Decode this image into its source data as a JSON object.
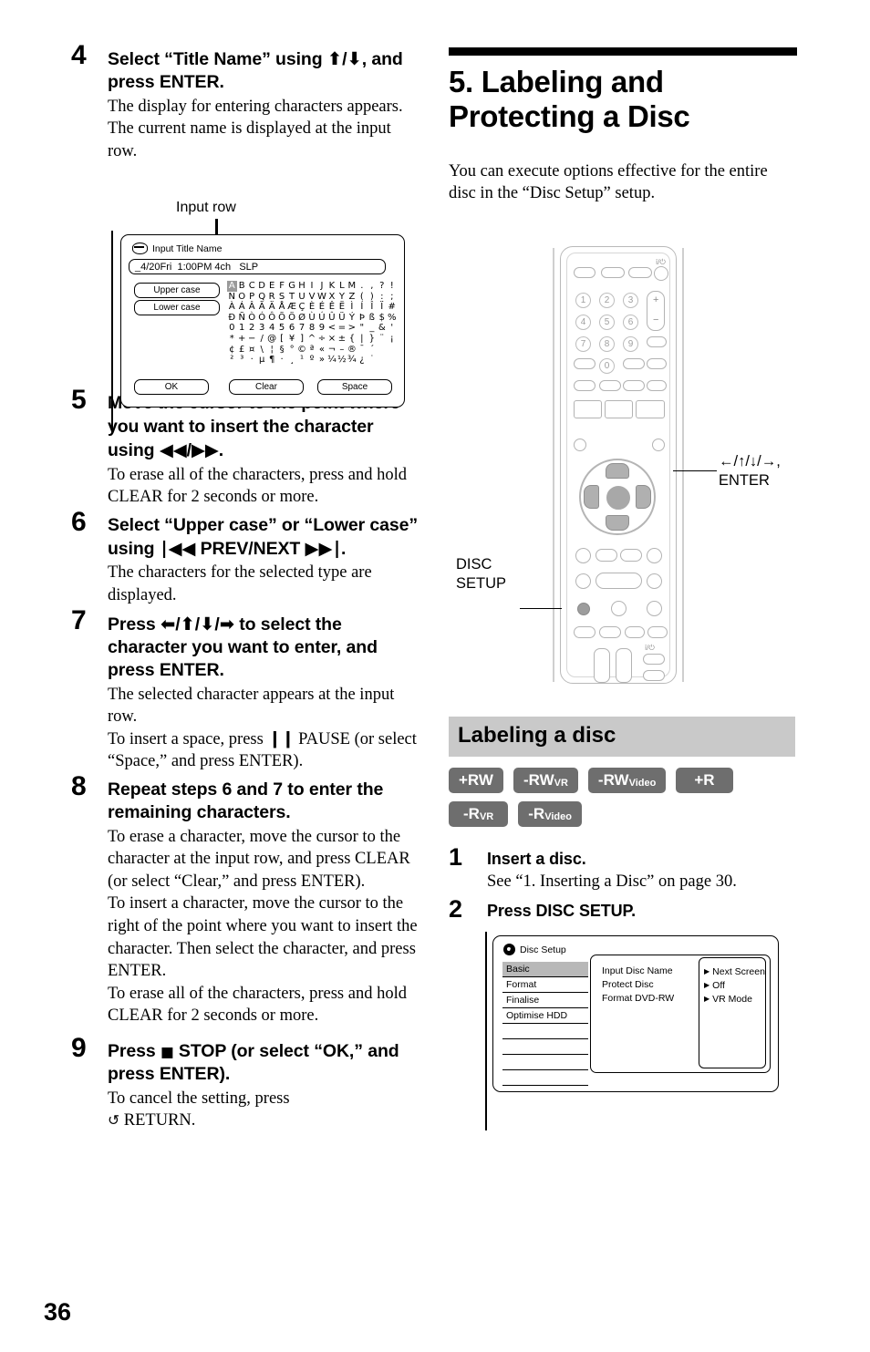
{
  "page_number": "36",
  "left_column": {
    "steps": [
      {
        "num": "4",
        "heading": "Select “Title Name” using ↑/↓, and press ENTER.",
        "body": [
          "The display for entering characters appears.",
          "The current name is displayed at the input row."
        ]
      },
      {
        "num": "5",
        "heading": "Move the cursor to the point where you want to insert the character using ◀◀/▶▶.",
        "body": [
          "To erase all of the characters, press and hold CLEAR for 2 seconds or more."
        ]
      },
      {
        "num": "6",
        "heading": "Select “Upper case” or “Lower case” using |◀◀ PREV/NEXT ▶▶|.",
        "body": [
          "The characters for the selected type are displayed."
        ]
      },
      {
        "num": "7",
        "heading": "Press ←/↑/↓/→ to select the character you want to enter, and press ENTER.",
        "body": [
          "The selected character appears at the input row.",
          "To insert a space, press ‖ PAUSE (or select “Space,” and press ENTER)."
        ]
      },
      {
        "num": "8",
        "heading": "Repeat steps 6 and 7 to enter the remaining characters.",
        "body": [
          "To erase a character, move the cursor to the character at the input row, and press CLEAR (or select “Clear,” and press ENTER).",
          "To insert a character, move the cursor to the right of the point where you want to insert the character. Then select the character, and press ENTER.",
          "To erase all of the characters, press and hold CLEAR for 2 seconds or more."
        ]
      },
      {
        "num": "9",
        "heading": "Press ■ STOP (or select “OK,” and press ENTER).",
        "body": [
          "To cancel the setting, press ۩ RETURN."
        ]
      }
    ],
    "input_screen": {
      "callout_label": "Input row",
      "title": "Input Title Name",
      "input_value": "_4/20Fri  1:00PM 4ch   SLP",
      "case_buttons": [
        "Upper case",
        "Lower case"
      ],
      "bottom_buttons": [
        "OK",
        "Clear",
        "Space"
      ],
      "charmap_rows": [
        [
          "A",
          "B",
          "C",
          "D",
          "E",
          "F",
          "G",
          "H",
          "I",
          "J",
          "K",
          "L",
          "M",
          ".",
          ",",
          "?",
          "!"
        ],
        [
          "N",
          "O",
          "P",
          "Q",
          "R",
          "S",
          "T",
          "U",
          "V",
          "W",
          "X",
          "Y",
          "Z",
          "(",
          ")",
          ":",
          ";"
        ],
        [
          "À",
          "Á",
          "Â",
          "Ã",
          "Ä",
          "Å",
          "Æ",
          "Ç",
          "È",
          "É",
          "Ê",
          "Ë",
          "Ì",
          "Í",
          "Î",
          "Ï",
          "#"
        ],
        [
          "Ð",
          "Ñ",
          "Ò",
          "Ó",
          "Ô",
          "Õ",
          "Ö",
          "Ø",
          "Ù",
          "Ú",
          "Û",
          "Ü",
          "Ý",
          "Þ",
          "ß",
          "$",
          "%"
        ],
        [
          "0",
          "1",
          "2",
          "3",
          "4",
          "5",
          "6",
          "7",
          "8",
          "9",
          "<",
          "=",
          ">",
          "\"",
          "_",
          "&",
          "'"
        ],
        [
          "*",
          "+",
          "−",
          "/",
          "@",
          "[",
          "¥",
          "]",
          "^",
          "÷",
          "×",
          "±",
          "{",
          "|",
          "}",
          "¨",
          "¡"
        ],
        [
          "¢",
          "£",
          "¤",
          "\\",
          "¦",
          "§",
          "°",
          "©",
          "ª",
          "«",
          "¬",
          "–",
          "®",
          "¯",
          "´",
          "",
          " "
        ],
        [
          "²",
          "³",
          "·",
          "µ",
          "¶",
          "·",
          "¸",
          "¹",
          "º",
          "»",
          "¼",
          "½",
          "¾",
          "¿",
          "˙",
          "",
          ""
        ]
      ],
      "selected_char": "A"
    }
  },
  "right_column": {
    "section_title": "5. Labeling and Protecting a Disc",
    "intro": "You can execute options effective for the entire disc in the “Disc Setup” setup.",
    "remote_callouts": {
      "dpad": "←/↑/↓/→,\nENTER",
      "dpad_line1": "←/↑/↓/→,",
      "dpad_line2": "ENTER",
      "disc_setup_line1": "DISC",
      "disc_setup_line2": "SETUP"
    },
    "remote_number_keys": [
      "1",
      "2",
      "3",
      "4",
      "5",
      "6",
      "7",
      "8",
      "9",
      "0"
    ],
    "subsection": {
      "title": "Labeling a disc",
      "badges": [
        {
          "main": "+RW",
          "sub": ""
        },
        {
          "main": "-RW",
          "sub": "VR"
        },
        {
          "main": "-RW",
          "sub": "Video"
        },
        {
          "main": "+R",
          "sub": ""
        },
        {
          "main": "-R",
          "sub": "VR"
        },
        {
          "main": "-R",
          "sub": "Video"
        }
      ],
      "steps": [
        {
          "num": "1",
          "heading": "Insert a disc.",
          "body": [
            "See “1. Inserting a Disc” on page 30."
          ]
        },
        {
          "num": "2",
          "heading": "Press DISC SETUP.",
          "body": []
        }
      ]
    },
    "disc_setup_screen": {
      "title": "Disc Setup",
      "menu": [
        "Basic",
        "Format",
        "Finalise",
        "Optimise HDD"
      ],
      "selected_menu": "Basic",
      "options": [
        "Input Disc Name",
        "Protect Disc",
        "Format DVD-RW"
      ],
      "values": [
        "Next Screen",
        "Off",
        "VR Mode"
      ]
    }
  },
  "colors": {
    "badge_bg": "#6e6e6e",
    "greybar_bg": "#c9c9c9",
    "selection_grey": "#b8b8b8"
  }
}
